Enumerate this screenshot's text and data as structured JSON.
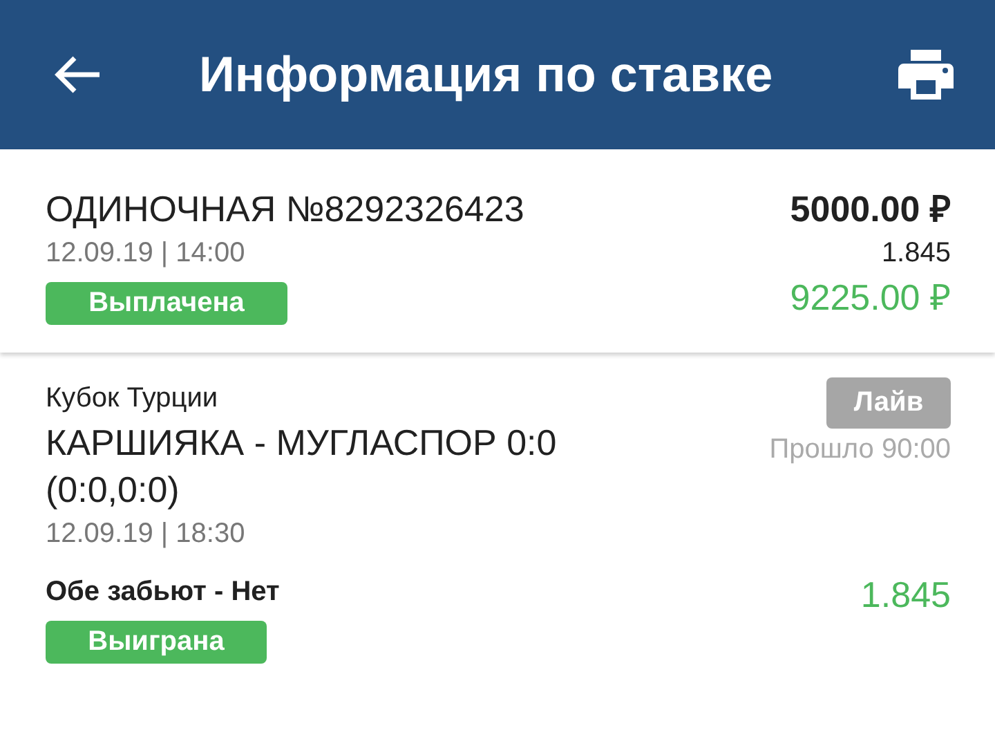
{
  "header": {
    "title": "Информация по ставке"
  },
  "bet": {
    "title": "ОДИНОЧНАЯ №8292326423",
    "datetime": "12.09.19 | 14:00",
    "status": "Выплачена",
    "stake": "5000.00 ₽",
    "odds": "1.845",
    "payout": "9225.00 ₽"
  },
  "events": [
    {
      "league": "Кубок Турции",
      "match": "КАРШИЯКА - МУГЛАСПОР 0:0 (0:0,0:0)",
      "datetime": "12.09.19 | 18:30",
      "live_badge": "Лайв",
      "elapsed": "Прошло 90:00",
      "market": "Обе забьют - Нет",
      "odds": "1.845",
      "status": "Выиграна"
    }
  ]
}
